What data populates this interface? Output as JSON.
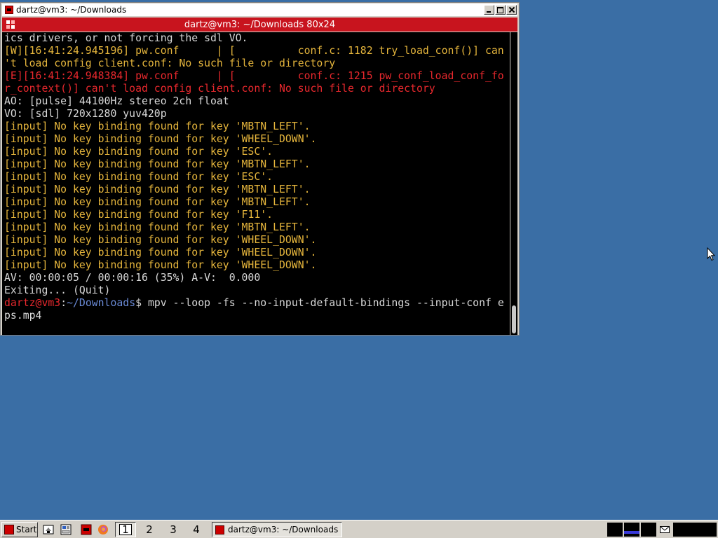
{
  "window": {
    "title": "dartz@vm3: ~/Downloads",
    "terminal_title": "dartz@vm3: ~/Downloads 80x24"
  },
  "terminal": {
    "lines": [
      {
        "color": "white",
        "text": "ics drivers, or not forcing the sdl VO."
      },
      {
        "color": "yellow",
        "text": "[W][16:41:24.945196] pw.conf      | [          conf.c: 1182 try_load_conf()] can"
      },
      {
        "color": "yellow",
        "text": "'t load config client.conf: No such file or directory"
      },
      {
        "color": "red",
        "text": "[E][16:41:24.948384] pw.conf      | [          conf.c: 1215 pw_conf_load_conf_fo"
      },
      {
        "color": "red",
        "text": "r_context()] can't load config client.conf: No such file or directory"
      },
      {
        "color": "white",
        "text": "AO: [pulse] 44100Hz stereo 2ch float"
      },
      {
        "color": "white",
        "text": "VO: [sdl] 720x1280 yuv420p"
      },
      {
        "color": "yellow",
        "text": "[input] No key binding found for key 'MBTN_LEFT'."
      },
      {
        "color": "yellow",
        "text": "[input] No key binding found for key 'WHEEL_DOWN'."
      },
      {
        "color": "yellow",
        "text": "[input] No key binding found for key 'ESC'."
      },
      {
        "color": "yellow",
        "text": "[input] No key binding found for key 'MBTN_LEFT'."
      },
      {
        "color": "yellow",
        "text": "[input] No key binding found for key 'ESC'."
      },
      {
        "color": "yellow",
        "text": "[input] No key binding found for key 'MBTN_LEFT'."
      },
      {
        "color": "yellow",
        "text": "[input] No key binding found for key 'MBTN_LEFT'."
      },
      {
        "color": "yellow",
        "text": "[input] No key binding found for key 'F11'."
      },
      {
        "color": "yellow",
        "text": "[input] No key binding found for key 'MBTN_LEFT'."
      },
      {
        "color": "yellow",
        "text": "[input] No key binding found for key 'WHEEL_DOWN'."
      },
      {
        "color": "yellow",
        "text": "[input] No key binding found for key 'WHEEL_DOWN'."
      },
      {
        "color": "yellow",
        "text": "[input] No key binding found for key 'WHEEL_DOWN'."
      },
      {
        "color": "white",
        "text": "AV: 00:00:05 / 00:00:16 (35%) A-V:  0.000"
      },
      {
        "color": "white",
        "text": "Exiting... (Quit)"
      }
    ],
    "prompt": {
      "user_host": "dartz@vm3",
      "sep": ":",
      "path": "~/Downloads",
      "symbol": "$",
      "command": " mpv --loop -fs --no-input-default-bindings --input-conf e",
      "command_cont": "ps.mp4"
    },
    "colors": {
      "white": "#d8d8d8",
      "yellow": "#e5b53c",
      "red": "#e8282d",
      "path_blue": "#6a8ad6"
    }
  },
  "taskbar": {
    "start_label": "Start",
    "desktops": [
      "1",
      "2",
      "3",
      "4"
    ],
    "active_desktop": "1",
    "task_label": "dartz@vm3: ~/Downloads"
  },
  "colors": {
    "desktop": "#3a6ea5",
    "terminal_bar": "#c8141e"
  }
}
